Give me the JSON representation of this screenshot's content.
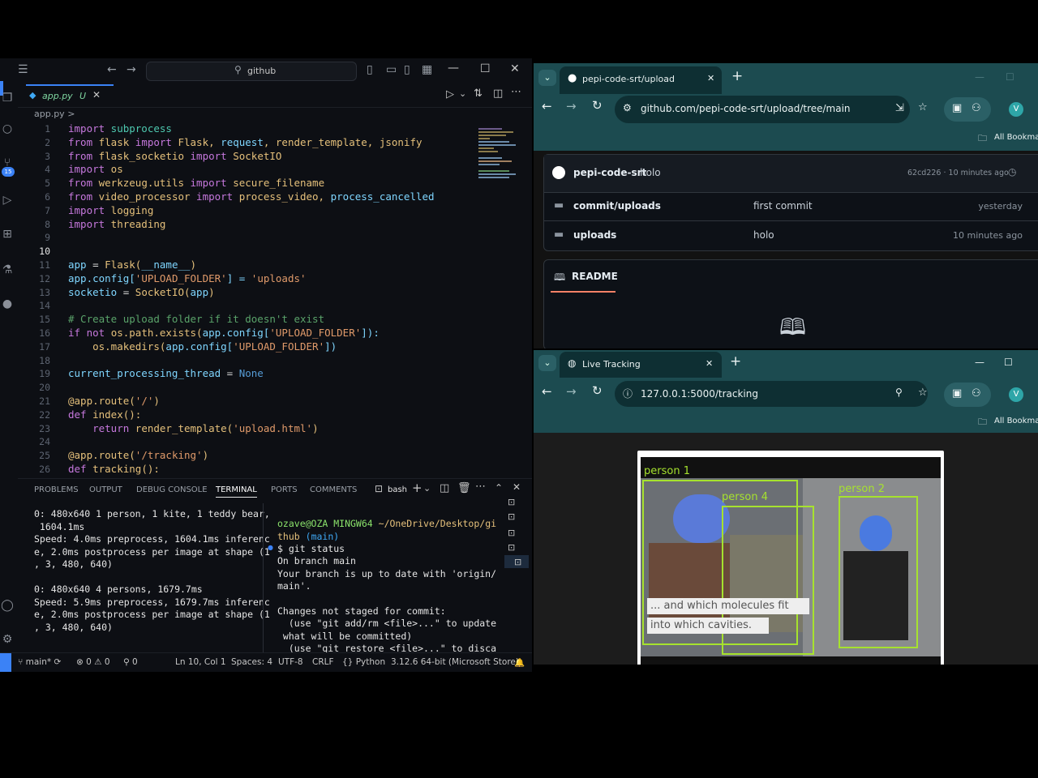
{
  "vscode": {
    "search_text": "github",
    "tab": {
      "filename": "app.py",
      "status": "U"
    },
    "breadcrumb": "app.py >",
    "lines": [
      {
        "n": "1"
      },
      {
        "n": "2"
      },
      {
        "n": "3"
      },
      {
        "n": "4"
      },
      {
        "n": "5"
      },
      {
        "n": "6"
      },
      {
        "n": "7"
      },
      {
        "n": "8"
      },
      {
        "n": "9"
      },
      {
        "n": "10"
      },
      {
        "n": "11"
      },
      {
        "n": "12"
      },
      {
        "n": "13"
      },
      {
        "n": "14"
      },
      {
        "n": "15"
      },
      {
        "n": "16"
      },
      {
        "n": "17"
      },
      {
        "n": "18"
      },
      {
        "n": "19"
      },
      {
        "n": "20"
      },
      {
        "n": "21"
      },
      {
        "n": "22"
      },
      {
        "n": "23"
      },
      {
        "n": "24"
      },
      {
        "n": "25"
      },
      {
        "n": "26"
      }
    ],
    "code": {
      "l1": [
        [
          "import",
          "kw"
        ],
        [
          " subprocess",
          "cls"
        ]
      ],
      "l2": [
        [
          "from",
          "kw"
        ],
        [
          " flask ",
          "fn"
        ],
        [
          "import",
          "kw"
        ],
        [
          " Flask, ",
          "fn"
        ],
        [
          "request",
          "var"
        ],
        [
          ", render_template, jsonify",
          "fn"
        ]
      ],
      "l3": [
        [
          "from",
          "kw"
        ],
        [
          " flask_socketio ",
          "fn"
        ],
        [
          "import",
          "kw"
        ],
        [
          " SocketIO",
          "fn"
        ]
      ],
      "l4": [
        [
          "import",
          "kw"
        ],
        [
          " os",
          "fn"
        ]
      ],
      "l5": [
        [
          "from",
          "kw"
        ],
        [
          " werkzeug.utils ",
          "fn"
        ],
        [
          "import",
          "kw"
        ],
        [
          " secure_filename",
          "fn"
        ]
      ],
      "l6": [
        [
          "from",
          "kw"
        ],
        [
          " video_processor ",
          "fn"
        ],
        [
          "import",
          "kw"
        ],
        [
          " process_video, ",
          "fn"
        ],
        [
          "process_cancelled",
          "var"
        ]
      ],
      "l7": [
        [
          "import",
          "kw"
        ],
        [
          " logging",
          "fn"
        ]
      ],
      "l8": [
        [
          "import",
          "kw"
        ],
        [
          " threading",
          "fn"
        ]
      ],
      "l11": [
        [
          "app",
          "var"
        ],
        [
          " = ",
          "txt"
        ],
        [
          "Flask(",
          "fn"
        ],
        [
          "__name__",
          "var"
        ],
        [
          ")",
          "fn"
        ]
      ],
      "l12": [
        [
          "app.config[",
          "var"
        ],
        [
          "'UPLOAD_FOLDER'",
          "str"
        ],
        [
          "] = ",
          "var"
        ],
        [
          "'uploads'",
          "str"
        ]
      ],
      "l13": [
        [
          "socketio",
          "var"
        ],
        [
          " = ",
          "txt"
        ],
        [
          "SocketIO(",
          "fn"
        ],
        [
          "app",
          "var"
        ],
        [
          ")",
          "fn"
        ]
      ],
      "l15": [
        [
          "# Create upload folder if it doesn't exist",
          "cm"
        ]
      ],
      "l16": [
        [
          "if not ",
          "kw"
        ],
        [
          "os.path.exists(",
          "fn"
        ],
        [
          "app.config[",
          "var"
        ],
        [
          "'UPLOAD_FOLDER'",
          "str"
        ],
        [
          "]):",
          "var"
        ]
      ],
      "l17": [
        [
          "    os.makedirs(",
          "fn"
        ],
        [
          "app.config[",
          "var"
        ],
        [
          "'UPLOAD_FOLDER'",
          "str"
        ],
        [
          "])",
          "var"
        ]
      ],
      "l19": [
        [
          "current_processing_thread",
          "var"
        ],
        [
          " = ",
          "txt"
        ],
        [
          "None",
          "none"
        ]
      ],
      "l21": [
        [
          "@app.route(",
          "fn"
        ],
        [
          "'/'",
          "str"
        ],
        [
          ")",
          "fn"
        ]
      ],
      "l22": [
        [
          "def ",
          "kw"
        ],
        [
          "index():",
          "fn"
        ]
      ],
      "l23": [
        [
          "    return ",
          "kw"
        ],
        [
          "render_template(",
          "fn"
        ],
        [
          "'upload.html'",
          "str"
        ],
        [
          ")",
          "fn"
        ]
      ],
      "l25": [
        [
          "@app.route(",
          "fn"
        ],
        [
          "'/tracking'",
          "str"
        ],
        [
          ")",
          "fn"
        ]
      ],
      "l26": [
        [
          "def ",
          "kw"
        ],
        [
          "tracking():",
          "fn"
        ]
      ]
    },
    "panel_tabs": [
      "PROBLEMS",
      "OUTPUT",
      "DEBUG CONSOLE",
      "TERMINAL",
      "PORTS",
      "COMMENTS"
    ],
    "shell": "bash",
    "term_left": [
      "0: 480x640 1 person, 1 kite, 1 teddy bear,",
      " 1604.1ms",
      "Speed: 4.0ms preprocess, 1604.1ms inferenc",
      "e, 2.0ms postprocess per image at shape (1",
      ", 3, 480, 640)",
      "",
      "0: 480x640 4 persons, 1679.7ms",
      "Speed: 5.9ms preprocess, 1679.7ms inferenc",
      "e, 2.0ms postprocess per image at shape (1",
      ", 3, 480, 640)"
    ],
    "term_prompt_user": "ozave@OZA MINGW64",
    "term_prompt_path": "~/OneDrive/Desktop/gi",
    "term_prompt_path2": "thub",
    "term_branch": "(main)",
    "term_right": [
      "$ git status",
      "On branch main",
      "Your branch is up to date with 'origin/",
      "main'.",
      "",
      "Changes not staged for commit:",
      "  (use \"git add/rm <file>...\" to update",
      " what will be committed)",
      "  (use \"git restore <file>...\" to disca"
    ],
    "status": {
      "branch": "main*",
      "errors": "0",
      "warnings": "0",
      "ports": "0",
      "position": "Ln 10, Col 1",
      "spaces": "Spaces: 4",
      "encoding": "UTF-8",
      "eol": "CRLF",
      "language": "Python",
      "interpreter": "3.12.6 64-bit (Microsoft Store)"
    },
    "badge_count": "15"
  },
  "github_window": {
    "tab_title": "pepi-code-srt/upload",
    "url": "github.com/pepi-code-srt/upload/tree/main",
    "bookmarks": "All Bookmar",
    "commit": {
      "author": "pepi-code-srt",
      "message": "holo",
      "hash_time": "62cd226 · 10 minutes ago"
    },
    "files": [
      {
        "name": "commit/uploads",
        "message": "first commit",
        "time": "yesterday"
      },
      {
        "name": "uploads",
        "message": "holo",
        "time": "10 minutes ago"
      }
    ],
    "readme_label": "README"
  },
  "tracking_window": {
    "tab_title": "Live Tracking",
    "url": "127.0.0.1:5000/tracking",
    "bookmarks": "All Bookmar",
    "labels": {
      "p1": "person 1",
      "p4": "person 4",
      "p2": "person 2"
    },
    "caption_line1": "... and which molecules fit",
    "caption_line2": "into which cavities."
  },
  "colors": {
    "accent": "#3b82f6",
    "teal": "#1c4b50",
    "box": "#a6e22e"
  }
}
